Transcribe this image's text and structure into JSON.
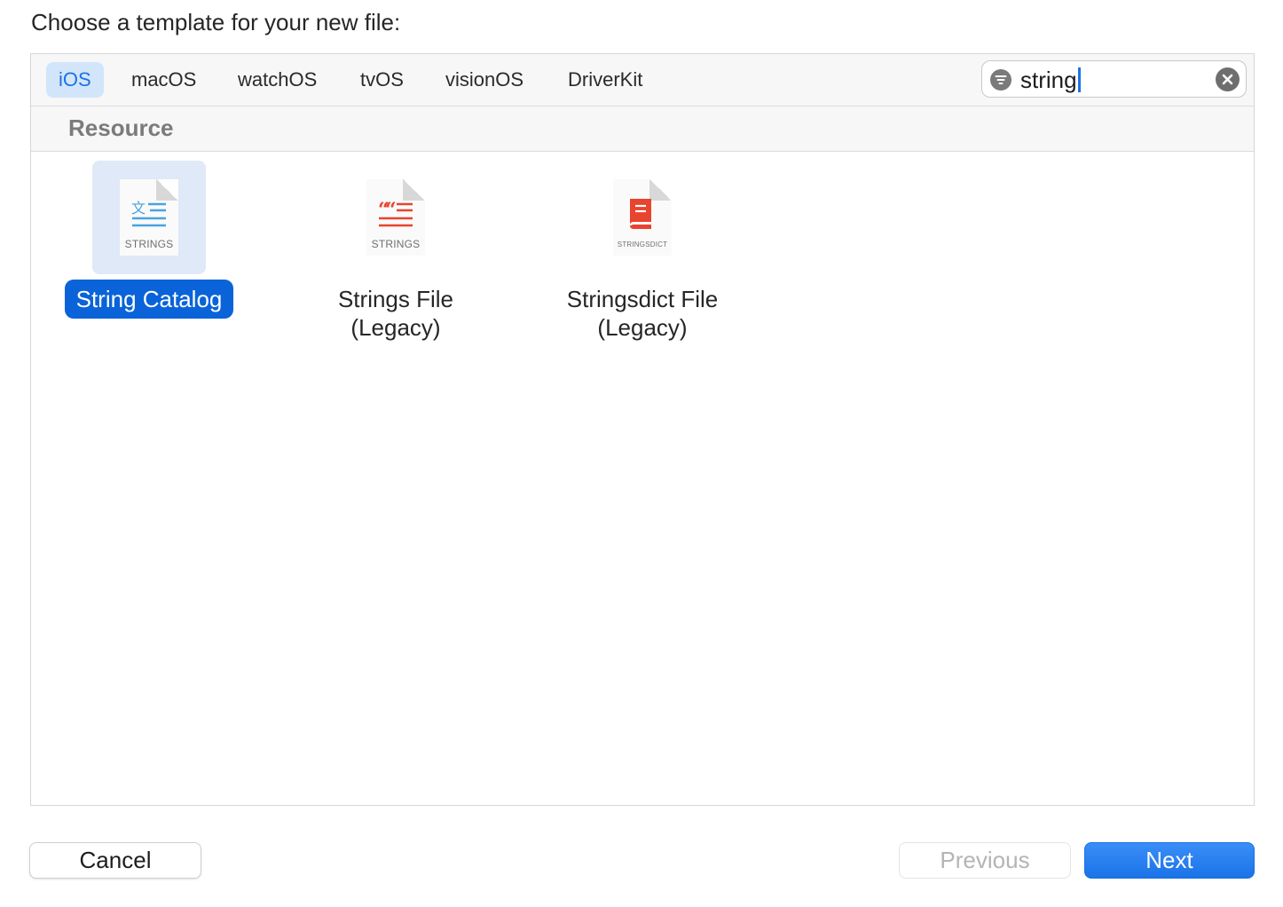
{
  "dialog": {
    "title": "Choose a template for your new file:"
  },
  "platform_tabs": [
    {
      "label": "iOS",
      "selected": true
    },
    {
      "label": "macOS",
      "selected": false
    },
    {
      "label": "watchOS",
      "selected": false
    },
    {
      "label": "tvOS",
      "selected": false
    },
    {
      "label": "visionOS",
      "selected": false
    },
    {
      "label": "DriverKit",
      "selected": false
    }
  ],
  "search": {
    "value": "string",
    "filter_icon": "filter-icon",
    "clear_icon": "clear-icon"
  },
  "section": {
    "title": "Resource"
  },
  "templates": [
    {
      "name": "String Catalog",
      "doc_label": "STRINGS",
      "icon": "string-catalog-icon",
      "selected": true,
      "accent": "#4aa3df"
    },
    {
      "name": "Strings File\n(Legacy)",
      "doc_label": "STRINGS",
      "icon": "strings-file-icon",
      "selected": false,
      "accent": "#e8442f"
    },
    {
      "name": "Stringsdict File\n(Legacy)",
      "doc_label": "STRINGSDICT",
      "icon": "stringsdict-file-icon",
      "selected": false,
      "accent": "#e8442f"
    }
  ],
  "buttons": {
    "cancel": "Cancel",
    "previous": "Previous",
    "next": "Next"
  },
  "colors": {
    "accent": "#1a73e8",
    "selection": "#0a63d8",
    "disabled_text": "#b4b4b4"
  }
}
